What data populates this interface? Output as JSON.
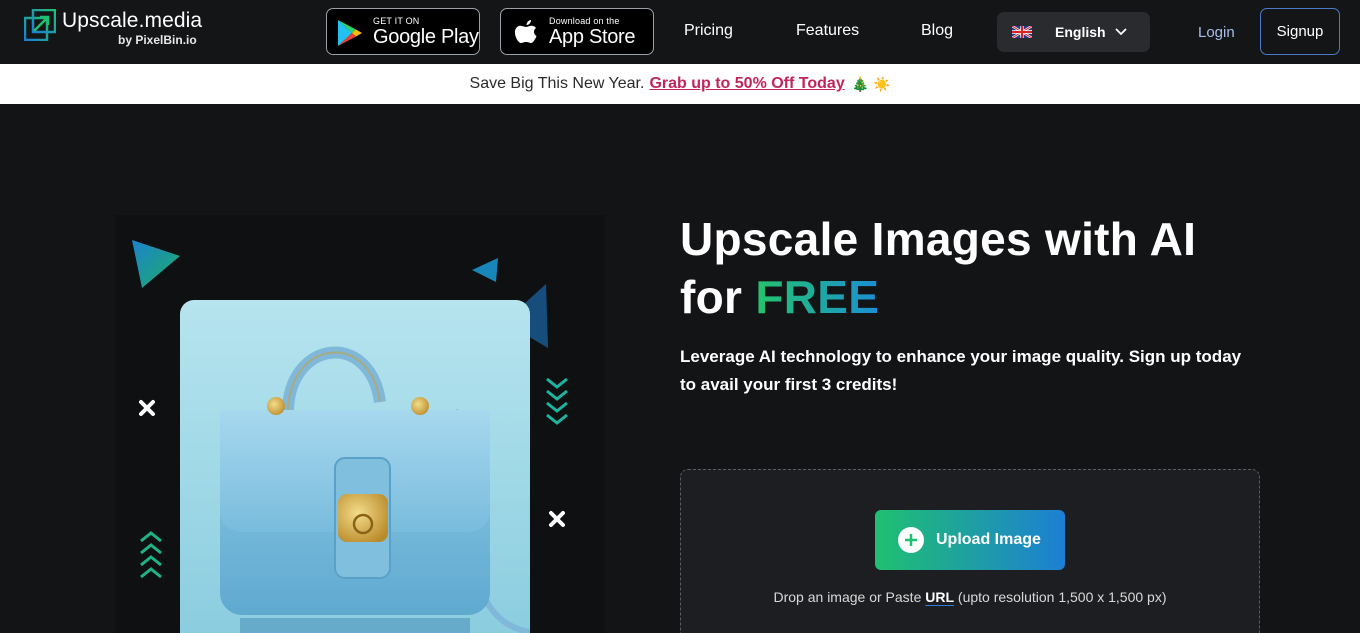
{
  "brand": {
    "name": "Upscale.media",
    "byline": "by PixelBin.io"
  },
  "stores": {
    "google": {
      "small": "GET IT ON",
      "big": "Google Play"
    },
    "apple": {
      "small": "Download on the",
      "big": "App Store"
    }
  },
  "nav": {
    "links": [
      "Pricing",
      "Features",
      "Blog"
    ]
  },
  "language": {
    "selected": "English"
  },
  "auth": {
    "login": "Login",
    "signup": "Signup"
  },
  "promo": {
    "text": "Save Big This New Year.",
    "link": "Grab up to 50% Off Today",
    "emoji": "🎄 ☀️"
  },
  "hero": {
    "title_line1": "Upscale Images with AI",
    "title_for": "for",
    "title_free": "FREE",
    "subtitle": "Leverage AI technology to enhance your image quality. Sign up today to avail your first 3 credits!"
  },
  "upload": {
    "button": "Upload Image",
    "drop_prefix": "Drop an image or Paste",
    "drop_url": "URL",
    "drop_suffix": "(upto resolution 1,500 x 1,500 px)"
  },
  "colors": {
    "accent_pink": "#c2255c",
    "green": "#1fc070",
    "blue": "#1d7fd4"
  }
}
